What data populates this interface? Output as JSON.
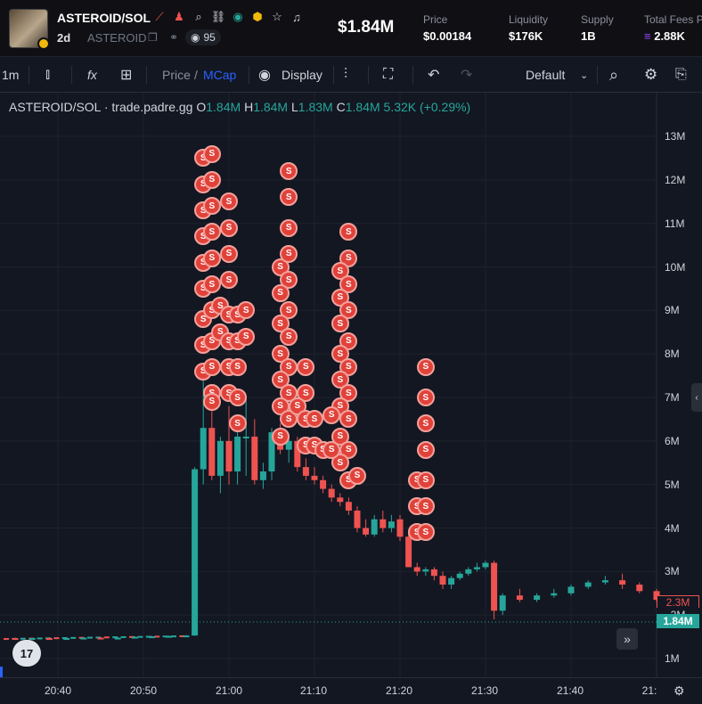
{
  "header": {
    "pair": "ASTEROID/SOL",
    "age": "2d",
    "ticker": "ASTEROID",
    "watchers": "95",
    "market_cap": "$1.84M",
    "stats": [
      {
        "label": "Price",
        "value": "$0.00184"
      },
      {
        "label": "Liquidity",
        "value": "$176K"
      },
      {
        "label": "Supply",
        "value": "1B"
      },
      {
        "label": "Total Fees P",
        "value": "2.88K"
      }
    ]
  },
  "toolbar": {
    "interval": "1m",
    "fx": "fx",
    "price_label": "Price",
    "slash": "/",
    "mcap_label": "MCap",
    "display_label": "Display",
    "layout_label": "Default"
  },
  "legend": {
    "title": "ASTEROID/SOL · trade.padre.gg",
    "o_key": "O",
    "o_val": "1.84M",
    "h_key": "H",
    "h_val": "1.84M",
    "l_key": "L",
    "l_val": "1.83M",
    "c_key": "C",
    "c_val": "1.84M",
    "change": "5.32K (+0.29%)"
  },
  "axis": {
    "y_ticks": [
      "13M",
      "12M",
      "11M",
      "10M",
      "9M",
      "8M",
      "7M",
      "6M",
      "5M",
      "4M",
      "3M",
      "1M"
    ],
    "x_ticks": [
      "20:40",
      "20:50",
      "21:00",
      "21:10",
      "21:20",
      "21:30",
      "21:40",
      "21:"
    ]
  },
  "price_tags": {
    "alert": "2.3M",
    "last_partial": "2M",
    "current": "1.84M"
  },
  "tv_logo": "17",
  "marker_letter": "S",
  "colors": {
    "up": "#26a69a",
    "down": "#ef5350",
    "marker": "#e0423a",
    "accent": "#2962ff"
  },
  "chart_data": {
    "type": "candlestick",
    "title": "",
    "x_unit": "time (1m)",
    "y_unit": "market cap (M)",
    "ylim": [
      0.7,
      13.5
    ],
    "candles": [
      {
        "t": "20:35",
        "o": 1.47,
        "h": 1.48,
        "l": 1.45,
        "c": 1.46
      },
      {
        "t": "20:37",
        "o": 1.46,
        "h": 1.48,
        "l": 1.44,
        "c": 1.47
      },
      {
        "t": "20:39",
        "o": 1.47,
        "h": 1.49,
        "l": 1.45,
        "c": 1.46
      },
      {
        "t": "20:41",
        "o": 1.46,
        "h": 1.48,
        "l": 1.44,
        "c": 1.47
      },
      {
        "t": "20:43",
        "o": 1.47,
        "h": 1.49,
        "l": 1.45,
        "c": 1.48
      },
      {
        "t": "20:45",
        "o": 1.48,
        "h": 1.5,
        "l": 1.46,
        "c": 1.47
      },
      {
        "t": "20:47",
        "o": 1.47,
        "h": 1.49,
        "l": 1.45,
        "c": 1.48
      },
      {
        "t": "20:49",
        "o": 1.48,
        "h": 1.51,
        "l": 1.46,
        "c": 1.5
      },
      {
        "t": "20:51",
        "o": 1.5,
        "h": 1.52,
        "l": 1.48,
        "c": 1.51
      },
      {
        "t": "20:53",
        "o": 1.51,
        "h": 1.53,
        "l": 1.49,
        "c": 1.52
      },
      {
        "t": "20:55",
        "o": 1.52,
        "h": 1.54,
        "l": 1.5,
        "c": 1.53
      },
      {
        "t": "20:56",
        "o": 1.53,
        "h": 5.4,
        "l": 1.52,
        "c": 5.35
      },
      {
        "t": "20:57",
        "o": 5.35,
        "h": 7.5,
        "l": 5.0,
        "c": 6.3
      },
      {
        "t": "20:58",
        "o": 6.3,
        "h": 6.9,
        "l": 5.1,
        "c": 5.2
      },
      {
        "t": "20:59",
        "o": 5.2,
        "h": 6.1,
        "l": 4.8,
        "c": 6.0
      },
      {
        "t": "21:00",
        "o": 6.0,
        "h": 6.8,
        "l": 5.0,
        "c": 5.3
      },
      {
        "t": "21:01",
        "o": 5.3,
        "h": 6.2,
        "l": 5.0,
        "c": 6.1
      },
      {
        "t": "21:02",
        "o": 6.1,
        "h": 7.0,
        "l": 5.2,
        "c": 6.1
      },
      {
        "t": "21:03",
        "o": 6.1,
        "h": 6.5,
        "l": 5.0,
        "c": 5.1
      },
      {
        "t": "21:04",
        "o": 5.1,
        "h": 5.5,
        "l": 4.9,
        "c": 5.3
      },
      {
        "t": "21:05",
        "o": 5.3,
        "h": 6.3,
        "l": 5.1,
        "c": 6.2
      },
      {
        "t": "21:06",
        "o": 6.0,
        "h": 6.4,
        "l": 5.7,
        "c": 5.8
      },
      {
        "t": "21:07",
        "o": 5.8,
        "h": 6.1,
        "l": 5.5,
        "c": 6.0
      },
      {
        "t": "21:08",
        "o": 6.0,
        "h": 6.1,
        "l": 5.3,
        "c": 5.4
      },
      {
        "t": "21:09",
        "o": 5.4,
        "h": 5.6,
        "l": 5.1,
        "c": 5.2
      },
      {
        "t": "21:10",
        "o": 5.2,
        "h": 5.4,
        "l": 5.0,
        "c": 5.1
      },
      {
        "t": "21:11",
        "o": 5.1,
        "h": 5.2,
        "l": 4.8,
        "c": 4.9
      },
      {
        "t": "21:12",
        "o": 4.9,
        "h": 5.0,
        "l": 4.6,
        "c": 4.7
      },
      {
        "t": "21:13",
        "o": 4.7,
        "h": 4.8,
        "l": 4.5,
        "c": 4.6
      },
      {
        "t": "21:14",
        "o": 4.6,
        "h": 4.7,
        "l": 4.3,
        "c": 4.4
      },
      {
        "t": "21:15",
        "o": 4.4,
        "h": 4.5,
        "l": 3.9,
        "c": 4.0
      },
      {
        "t": "21:16",
        "o": 4.0,
        "h": 4.2,
        "l": 3.8,
        "c": 3.85
      },
      {
        "t": "21:17",
        "o": 3.85,
        "h": 4.3,
        "l": 3.8,
        "c": 4.2
      },
      {
        "t": "21:18",
        "o": 4.2,
        "h": 4.4,
        "l": 3.9,
        "c": 4.0
      },
      {
        "t": "21:19",
        "o": 4.0,
        "h": 4.3,
        "l": 3.9,
        "c": 4.15
      },
      {
        "t": "21:20",
        "o": 4.2,
        "h": 4.3,
        "l": 3.7,
        "c": 3.8
      },
      {
        "t": "21:21",
        "o": 3.8,
        "h": 3.9,
        "l": 3.1,
        "c": 3.1
      },
      {
        "t": "21:22",
        "o": 3.1,
        "h": 3.2,
        "l": 2.9,
        "c": 3.0
      },
      {
        "t": "21:23",
        "o": 3.0,
        "h": 3.1,
        "l": 2.9,
        "c": 3.05
      },
      {
        "t": "21:24",
        "o": 3.05,
        "h": 3.1,
        "l": 2.8,
        "c": 2.9
      },
      {
        "t": "21:25",
        "o": 2.9,
        "h": 3.0,
        "l": 2.6,
        "c": 2.7
      },
      {
        "t": "21:26",
        "o": 2.7,
        "h": 2.9,
        "l": 2.6,
        "c": 2.85
      },
      {
        "t": "21:27",
        "o": 2.85,
        "h": 3.0,
        "l": 2.8,
        "c": 2.95
      },
      {
        "t": "21:28",
        "o": 2.95,
        "h": 3.1,
        "l": 2.9,
        "c": 3.05
      },
      {
        "t": "21:29",
        "o": 3.05,
        "h": 3.2,
        "l": 3.0,
        "c": 3.1
      },
      {
        "t": "21:30",
        "o": 3.1,
        "h": 3.25,
        "l": 3.05,
        "c": 3.2
      },
      {
        "t": "21:31",
        "o": 3.2,
        "h": 3.25,
        "l": 1.9,
        "c": 2.1
      },
      {
        "t": "21:32",
        "o": 2.1,
        "h": 2.5,
        "l": 2.0,
        "c": 2.45
      },
      {
        "t": "21:34",
        "o": 2.45,
        "h": 2.6,
        "l": 2.3,
        "c": 2.35
      },
      {
        "t": "21:36",
        "o": 2.35,
        "h": 2.5,
        "l": 2.3,
        "c": 2.45
      },
      {
        "t": "21:38",
        "o": 2.45,
        "h": 2.6,
        "l": 2.4,
        "c": 2.5
      },
      {
        "t": "21:40",
        "o": 2.5,
        "h": 2.7,
        "l": 2.45,
        "c": 2.65
      },
      {
        "t": "21:42",
        "o": 2.65,
        "h": 2.8,
        "l": 2.6,
        "c": 2.75
      },
      {
        "t": "21:44",
        "o": 2.75,
        "h": 2.9,
        "l": 2.7,
        "c": 2.8
      },
      {
        "t": "21:46",
        "o": 2.8,
        "h": 2.95,
        "l": 2.6,
        "c": 2.7
      },
      {
        "t": "21:48",
        "o": 2.7,
        "h": 2.75,
        "l": 2.5,
        "c": 2.55
      },
      {
        "t": "21:50",
        "o": 2.55,
        "h": 2.6,
        "l": 2.3,
        "c": 2.35
      }
    ],
    "sell_markers": [
      {
        "t": "20:57",
        "y": 12.5
      },
      {
        "t": "20:58",
        "y": 12.6
      },
      {
        "t": "20:57",
        "y": 11.9
      },
      {
        "t": "20:58",
        "y": 12.0
      },
      {
        "t": "20:57",
        "y": 11.3
      },
      {
        "t": "20:58",
        "y": 11.4
      },
      {
        "t": "21:00",
        "y": 11.5
      },
      {
        "t": "20:57",
        "y": 10.7
      },
      {
        "t": "20:58",
        "y": 10.8
      },
      {
        "t": "21:00",
        "y": 10.9
      },
      {
        "t": "20:57",
        "y": 10.1
      },
      {
        "t": "20:58",
        "y": 10.2
      },
      {
        "t": "21:00",
        "y": 10.3
      },
      {
        "t": "20:57",
        "y": 9.5
      },
      {
        "t": "20:58",
        "y": 9.6
      },
      {
        "t": "21:00",
        "y": 9.7
      },
      {
        "t": "20:57",
        "y": 8.8
      },
      {
        "t": "20:58",
        "y": 9.0
      },
      {
        "t": "20:59",
        "y": 9.1
      },
      {
        "t": "21:00",
        "y": 8.9
      },
      {
        "t": "21:01",
        "y": 8.9
      },
      {
        "t": "21:02",
        "y": 9.0
      },
      {
        "t": "20:57",
        "y": 8.2
      },
      {
        "t": "20:58",
        "y": 8.3
      },
      {
        "t": "20:59",
        "y": 8.5
      },
      {
        "t": "21:00",
        "y": 8.3
      },
      {
        "t": "21:01",
        "y": 8.3
      },
      {
        "t": "21:02",
        "y": 8.4
      },
      {
        "t": "20:57",
        "y": 7.6
      },
      {
        "t": "20:58",
        "y": 7.7
      },
      {
        "t": "21:00",
        "y": 7.7
      },
      {
        "t": "21:01",
        "y": 7.7
      },
      {
        "t": "20:58",
        "y": 7.1
      },
      {
        "t": "21:00",
        "y": 7.1
      },
      {
        "t": "21:01",
        "y": 7.0
      },
      {
        "t": "20:58",
        "y": 6.9
      },
      {
        "t": "21:01",
        "y": 6.4
      },
      {
        "t": "21:07",
        "y": 12.2
      },
      {
        "t": "21:07",
        "y": 11.6
      },
      {
        "t": "21:07",
        "y": 10.9
      },
      {
        "t": "21:06",
        "y": 10.0
      },
      {
        "t": "21:07",
        "y": 10.3
      },
      {
        "t": "21:07",
        "y": 9.7
      },
      {
        "t": "21:06",
        "y": 9.4
      },
      {
        "t": "21:07",
        "y": 9.0
      },
      {
        "t": "21:06",
        "y": 8.7
      },
      {
        "t": "21:07",
        "y": 8.4
      },
      {
        "t": "21:06",
        "y": 8.0
      },
      {
        "t": "21:07",
        "y": 7.7
      },
      {
        "t": "21:06",
        "y": 7.4
      },
      {
        "t": "21:07",
        "y": 7.1
      },
      {
        "t": "21:06",
        "y": 6.8
      },
      {
        "t": "21:07",
        "y": 6.5
      },
      {
        "t": "21:06",
        "y": 6.1
      },
      {
        "t": "21:09",
        "y": 7.7
      },
      {
        "t": "21:09",
        "y": 7.1
      },
      {
        "t": "21:08",
        "y": 6.8
      },
      {
        "t": "21:09",
        "y": 6.5
      },
      {
        "t": "21:10",
        "y": 6.5
      },
      {
        "t": "21:09",
        "y": 5.9
      },
      {
        "t": "21:10",
        "y": 5.9
      },
      {
        "t": "21:11",
        "y": 5.8
      },
      {
        "t": "21:14",
        "y": 10.8
      },
      {
        "t": "21:14",
        "y": 10.2
      },
      {
        "t": "21:13",
        "y": 9.9
      },
      {
        "t": "21:14",
        "y": 9.6
      },
      {
        "t": "21:13",
        "y": 9.3
      },
      {
        "t": "21:14",
        "y": 9.0
      },
      {
        "t": "21:13",
        "y": 8.7
      },
      {
        "t": "21:14",
        "y": 8.3
      },
      {
        "t": "21:13",
        "y": 8.0
      },
      {
        "t": "21:14",
        "y": 7.7
      },
      {
        "t": "21:13",
        "y": 7.4
      },
      {
        "t": "21:14",
        "y": 7.1
      },
      {
        "t": "21:13",
        "y": 6.8
      },
      {
        "t": "21:14",
        "y": 6.5
      },
      {
        "t": "21:13",
        "y": 6.1
      },
      {
        "t": "21:14",
        "y": 5.8
      },
      {
        "t": "21:13",
        "y": 5.5
      },
      {
        "t": "21:14",
        "y": 5.1
      },
      {
        "t": "21:15",
        "y": 5.2
      },
      {
        "t": "21:12",
        "y": 6.6
      },
      {
        "t": "21:12",
        "y": 5.8
      },
      {
        "t": "21:23",
        "y": 7.7
      },
      {
        "t": "21:23",
        "y": 7.0
      },
      {
        "t": "21:23",
        "y": 6.4
      },
      {
        "t": "21:23",
        "y": 5.8
      },
      {
        "t": "21:22",
        "y": 5.1
      },
      {
        "t": "21:23",
        "y": 5.1
      },
      {
        "t": "21:22",
        "y": 4.5
      },
      {
        "t": "21:23",
        "y": 4.5
      },
      {
        "t": "21:22",
        "y": 3.9
      },
      {
        "t": "21:23",
        "y": 3.9
      }
    ]
  }
}
